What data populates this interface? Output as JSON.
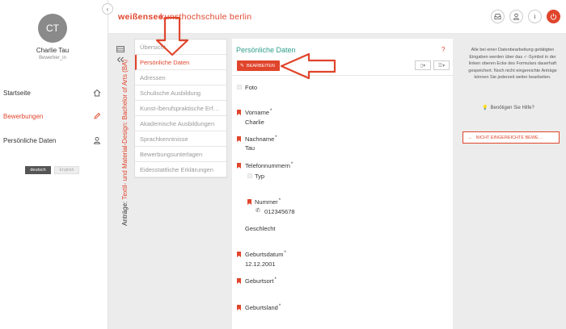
{
  "sidebar": {
    "avatar_initials": "CT",
    "user_name": "Charlie Tau",
    "user_role": "Bewerber_in",
    "nav": [
      {
        "label": "Startseite",
        "icon": "home-icon"
      },
      {
        "label": "Bewerbungen",
        "icon": "pencil-icon"
      },
      {
        "label": "Persönliche Daten",
        "icon": "user-icon"
      }
    ],
    "languages": [
      "deutsch",
      "English"
    ],
    "active_language": "deutsch"
  },
  "header": {
    "brand_part1": "weißensee",
    "brand_part2": "kunsthochschule berlin",
    "icons": [
      "inbox-icon",
      "user-icon",
      "info-icon",
      "power-icon"
    ]
  },
  "application": {
    "prefix": "Anträge: ",
    "course": "Textil- und Material-Design: Bachelor of Arts (BA)"
  },
  "menu": {
    "items": [
      "Übersicht",
      "Persönliche Daten",
      "Adressen",
      "Schulische Ausbildung",
      "Kunst-/berufspraktische Erf…",
      "Akademische Ausbildungen",
      "Sprachkenntnisse",
      "Bewerbungsunterlagen",
      "Eidesstattliche Erklärungen"
    ],
    "active_index": 1
  },
  "form": {
    "title": "Persönliche Daten",
    "help": "?",
    "edit_label": "BEARBEITEN",
    "fields": {
      "foto": "Foto",
      "vorname_label": "Vorname",
      "vorname_value": "Charlie",
      "nachname_label": "Nachname",
      "nachname_value": "Tau",
      "telefon_label": "Telefonnummern",
      "typ_label": "Typ",
      "nummer_label": "Nummer",
      "nummer_value": "012345678",
      "geschlecht_label": "Geschlecht",
      "geburtsdatum_label": "Geburtsdatum",
      "geburtsdatum_value": "12.12.2001",
      "geburtsort_label": "Geburtsort",
      "geburtsland_label": "Geburtsland",
      "required_mark": "*"
    }
  },
  "info": {
    "text": "Alle bei einer Datenbearbeitung getätigten Eingaben werden über das ✓-Symbol in der linken oberen Ecke des Formulars dauerhaft gespeichert. Noch nicht eingereichte Anträge können Sie jederzeit weiter bearbeiten.",
    "help_link": "Benötigen Sie Hilfe?",
    "not_submitted_button": "NICHT EINGEREICHTE BEWE…"
  },
  "colors": {
    "accent": "#e0452c",
    "title_teal": "#2e9e8c",
    "content_bg": "#ececec"
  }
}
